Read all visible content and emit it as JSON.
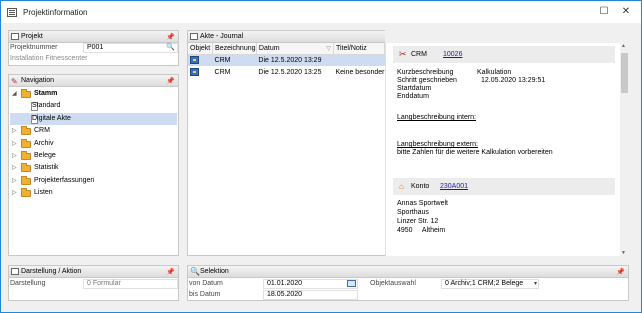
{
  "window": {
    "title": "Projektinformation",
    "minimize": "☐",
    "close": "✕"
  },
  "projekt": {
    "header": "Projekt",
    "label": "Projektnummer",
    "value": "P001",
    "subtitle": "Installation Fitnesscenter"
  },
  "navigation": {
    "header": "Navigation",
    "items": [
      {
        "label": "Stamm",
        "level": 0,
        "expanded": true,
        "kind": "folder"
      },
      {
        "label": "Standard",
        "level": 1,
        "kind": "doc"
      },
      {
        "label": "Digitale Akte",
        "level": 1,
        "kind": "doc",
        "selected": true
      },
      {
        "label": "CRM",
        "level": 0,
        "kind": "folder"
      },
      {
        "label": "Archiv",
        "level": 0,
        "kind": "folder"
      },
      {
        "label": "Belege",
        "level": 0,
        "kind": "folder"
      },
      {
        "label": "Statistik",
        "level": 0,
        "kind": "folder"
      },
      {
        "label": "Projekterfassungen",
        "level": 0,
        "kind": "folder"
      },
      {
        "label": "Listen",
        "level": 0,
        "kind": "folder"
      }
    ]
  },
  "journal": {
    "header": "Akte - Journal",
    "columns": [
      "Objekt",
      "Bezeichnung",
      "Datum",
      "Titel/Notiz"
    ],
    "rows": [
      {
        "bezeichnung": "CRM",
        "datum": "Die 12.5.2020 13:29",
        "titel": "",
        "selected": true
      },
      {
        "bezeichnung": "CRM",
        "datum": "Die 12.5.2020 13:25",
        "titel": "Keine besonder"
      }
    ]
  },
  "detail": {
    "crm_title": "CRM",
    "crm_number": "10026",
    "fields": [
      {
        "label": "Kurzbeschreibung",
        "value": "Kalkulation"
      },
      {
        "label": "Schritt geschrieben",
        "value": "12.05.2020 13:29:51"
      },
      {
        "label": "Startdatum",
        "value": ""
      },
      {
        "label": "Enddatum",
        "value": ""
      }
    ],
    "intern_label": "Langbeschreibung intern:",
    "extern_label": "Langbeschreibung extern:",
    "extern_text": "bitte Zahlen für die weitere Kalkulation vorbereiten",
    "konto_title": "Konto",
    "konto_number": "230A001",
    "address": [
      "Annas Sportwelt",
      "Sporthaus",
      "Linzer Str. 12",
      "4950     Altheim"
    ]
  },
  "darstellung": {
    "header": "Darstellung / Aktion",
    "label": "Darstellung",
    "value": "0 Formular"
  },
  "selektion": {
    "header": "Selektion",
    "von_label": "von Datum",
    "von_value": "01.01.2020",
    "bis_label": "bis Datum",
    "bis_value": "18.05.2020",
    "objekt_label": "Objektauswahl",
    "objekt_value": "0 Archiv;1 CRM;2 Belege"
  },
  "colors": {
    "selection": "#cddcf0",
    "accent": "#1e88d8",
    "pin": "#cc0000"
  }
}
